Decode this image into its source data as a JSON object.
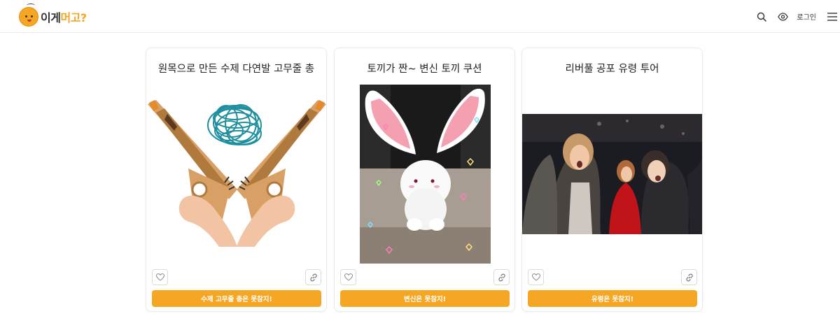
{
  "header": {
    "logo_text_a": "이게",
    "logo_text_b": "머고?",
    "login_label": "로그인"
  },
  "cards": [
    {
      "title": "원목으로 만든 수제 다연발 고무줄 총",
      "cta_label": "수제 고무줄 총은 못참지!",
      "image": "wooden-rubber-band-guns"
    },
    {
      "title": "토끼가 짠~ 변신 토끼 쿠션",
      "cta_label": "변신은 못참지!",
      "image": "bunny-cushion"
    },
    {
      "title": "리버풀 공포 유령 투어",
      "cta_label": "유령은 못참지!",
      "image": "ghost-tour-scared-people"
    }
  ],
  "colors": {
    "accent": "#f5a623",
    "border": "#eaeaea",
    "text": "#222222"
  }
}
